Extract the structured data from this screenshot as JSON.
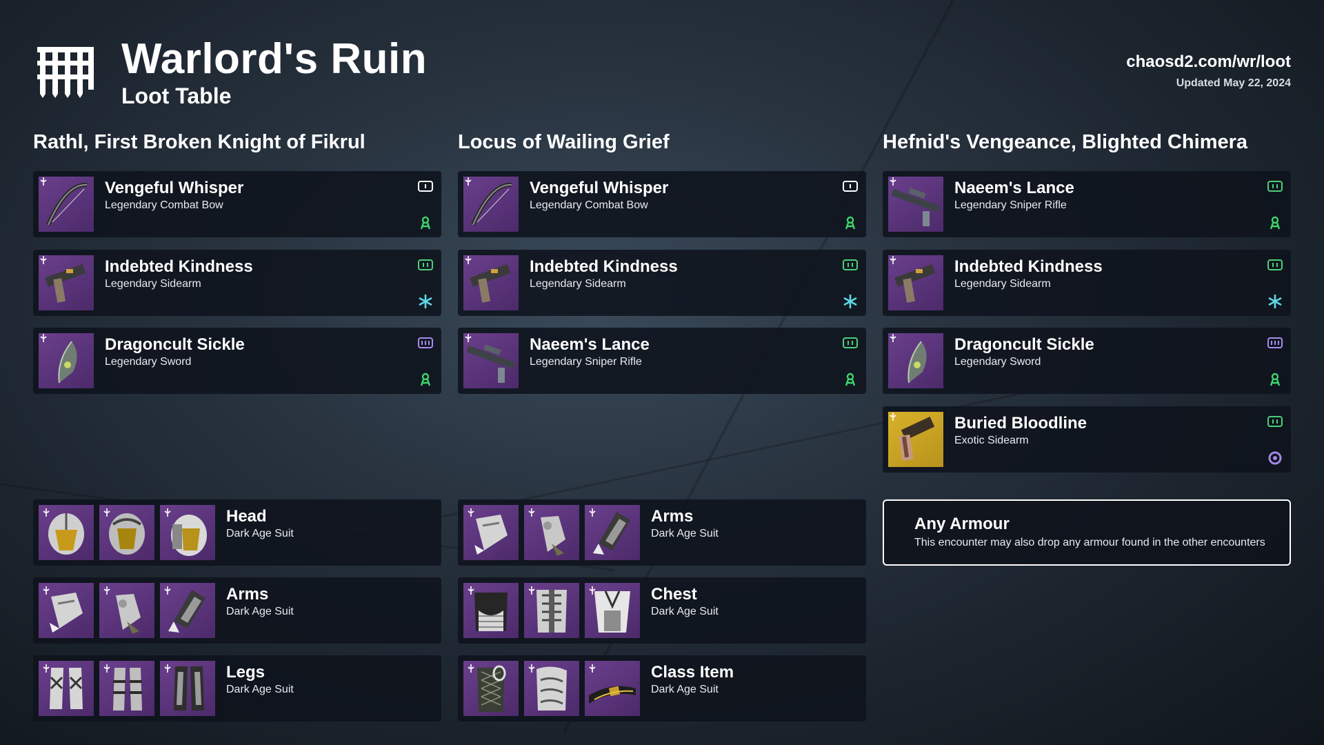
{
  "header": {
    "title": "Warlord's Ruin",
    "subtitle": "Loot Table",
    "site": "chaosd2.com/wr/loot",
    "updated": "Updated May 22, 2024"
  },
  "colors": {
    "kinetic": "#ffffff",
    "energy": "#4bd07a",
    "heavy": "#a58cf0",
    "strand": "#3fd56b",
    "stasis_arc": "#5fd8e8",
    "void": "#a487e8",
    "legendary": "#5a3678",
    "exotic": "#cfa826"
  },
  "columns": [
    {
      "title": "Rathl, First Broken Knight of Fikrul",
      "weapons": [
        {
          "name": "Vengeful Whisper",
          "type": "Legendary Combat Bow",
          "slot": "kinetic-slot-icon",
          "element": "strand-icon"
        },
        {
          "name": "Indebted Kindness",
          "type": "Legendary Sidearm",
          "slot": "energy-slot-icon",
          "element": "arc-icon"
        },
        {
          "name": "Dragoncult Sickle",
          "type": "Legendary Sword",
          "slot": "heavy-slot-icon",
          "element": "strand-icon"
        }
      ],
      "armor": [
        {
          "name": "Head",
          "type": "Dark Age Suit"
        },
        {
          "name": "Arms",
          "type": "Dark Age Suit"
        },
        {
          "name": "Legs",
          "type": "Dark Age Suit"
        }
      ]
    },
    {
      "title": "Locus of Wailing Grief",
      "weapons": [
        {
          "name": "Vengeful Whisper",
          "type": "Legendary Combat Bow",
          "slot": "kinetic-slot-icon",
          "element": "strand-icon"
        },
        {
          "name": "Indebted Kindness",
          "type": "Legendary Sidearm",
          "slot": "energy-slot-icon",
          "element": "arc-icon"
        },
        {
          "name": "Naeem's Lance",
          "type": "Legendary Sniper Rifle",
          "slot": "energy-slot-icon",
          "element": "strand-icon"
        }
      ],
      "armor": [
        {
          "name": "Arms",
          "type": "Dark Age Suit"
        },
        {
          "name": "Chest",
          "type": "Dark Age Suit"
        },
        {
          "name": "Class Item",
          "type": "Dark Age Suit"
        }
      ]
    },
    {
      "title": "Hefnid's Vengeance, Blighted Chimera",
      "weapons": [
        {
          "name": "Naeem's Lance",
          "type": "Legendary Sniper Rifle",
          "slot": "energy-slot-icon",
          "element": "strand-icon"
        },
        {
          "name": "Indebted Kindness",
          "type": "Legendary Sidearm",
          "slot": "energy-slot-icon",
          "element": "arc-icon"
        },
        {
          "name": "Dragoncult Sickle",
          "type": "Legendary Sword",
          "slot": "heavy-slot-icon",
          "element": "strand-icon"
        },
        {
          "name": "Buried Bloodline",
          "type": "Exotic Sidearm",
          "slot": "energy-slot-icon",
          "element": "void-icon"
        }
      ],
      "any_armour": {
        "name": "Any Armour",
        "description": "This encounter may also drop any armour found in the other encounters"
      }
    }
  ]
}
